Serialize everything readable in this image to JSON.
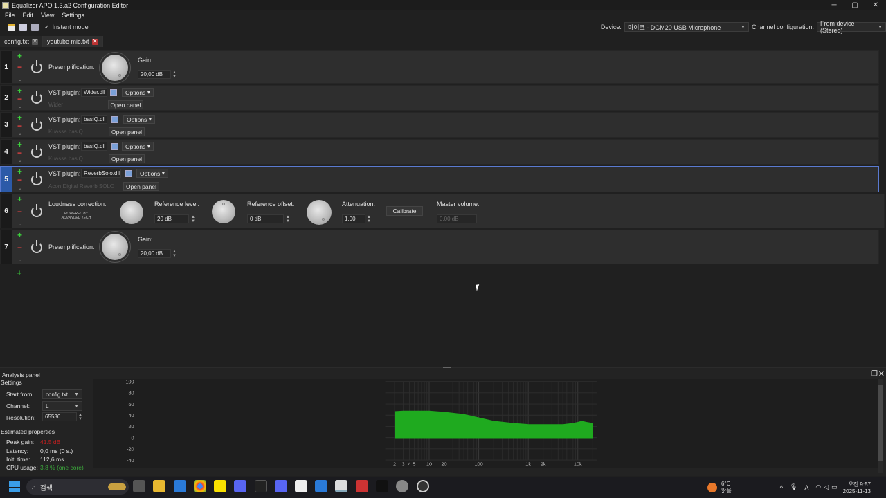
{
  "window": {
    "title": "Equalizer APO 1.3.a2 Configuration Editor",
    "min": "─",
    "max": "▢",
    "close": "✕"
  },
  "menu": [
    "File",
    "Edit",
    "View",
    "Settings"
  ],
  "toolbar": {
    "instant_mode": "Instant mode",
    "instant_checked": true
  },
  "device": {
    "label": "Device:",
    "value": "마이크 - DGM20 USB Microphone",
    "channel_label": "Channel configuration:",
    "channel_value": "From device (Stereo)"
  },
  "tabs": [
    {
      "label": "config.txt",
      "active": false
    },
    {
      "label": "youtube mic.txt",
      "active": true
    }
  ],
  "rows": [
    {
      "num": "1",
      "type": "preamp",
      "label": "Preamplification:",
      "gain_label": "Gain:",
      "gain_value": "20,00 dB"
    },
    {
      "num": "2",
      "type": "vst",
      "label": "VST plugin:",
      "file": "Wider.dll",
      "options": "Options",
      "open": "Open panel",
      "plugin_name": "Wider"
    },
    {
      "num": "3",
      "type": "vst",
      "label": "VST plugin:",
      "file": "basiQ.dll",
      "options": "Options",
      "open": "Open panel",
      "plugin_name": "Kuassa basiQ"
    },
    {
      "num": "4",
      "type": "vst",
      "label": "VST plugin:",
      "file": "basiQ.dll",
      "options": "Options",
      "open": "Open panel",
      "plugin_name": "Kuassa basiQ"
    },
    {
      "num": "5",
      "type": "vst",
      "label": "VST plugin:",
      "file": "ReverbSolo.dll",
      "options": "Options",
      "open": "Open panel",
      "plugin_name": "Acon Digital Reverb SOLO",
      "selected": true
    },
    {
      "num": "6",
      "type": "loudness",
      "label": "Loudness correction:",
      "powered_by": "POWERED BY ADVANCED TECH",
      "ref_level_label": "Reference level:",
      "ref_level": "20 dB",
      "ref_offset_label": "Reference offset:",
      "ref_offset": "0 dB",
      "atten_label": "Attenuation:",
      "atten": "1,00",
      "calibrate": "Calibrate",
      "master_label": "Master volume:",
      "master": "0,00 dB"
    },
    {
      "num": "7",
      "type": "preamp",
      "label": "Preamplification:",
      "gain_label": "Gain:",
      "gain_value": "20,00 dB"
    }
  ],
  "analysis": {
    "title": "Analysis panel",
    "settings": "Settings",
    "start_from_label": "Start from:",
    "start_from": "config.txt",
    "channel_label": "Channel:",
    "channel": "L",
    "resolution_label": "Resolution:",
    "resolution": "65536",
    "estimated": "Estimated properties",
    "peak_label": "Peak gain:",
    "peak": "41.5 dB",
    "peak_color": "#c02020",
    "latency_label": "Latency:",
    "latency": "0,0 ms (0 s.)",
    "init_label": "Init. time:",
    "init": "112,6 ms",
    "cpu_label": "CPU usage:",
    "cpu": "3,8 % (one core)",
    "cpu_color": "#3caa3c"
  },
  "chart_data": {
    "type": "area",
    "y_ticks": [
      "100",
      "80",
      "60",
      "40",
      "20",
      "0",
      "-20",
      "-40"
    ],
    "x_ticks": [
      "2",
      "3",
      "4",
      "5",
      "10",
      "20",
      "100",
      "1k",
      "2k",
      "10k"
    ],
    "ylim": [
      -40,
      100
    ],
    "x_scale": "log",
    "grid": true,
    "fill_color": "#1faa1f",
    "x": [
      2,
      3,
      5,
      10,
      20,
      50,
      100,
      200,
      500,
      1000,
      2000,
      5000,
      8000,
      10000,
      12000,
      15000,
      20000
    ],
    "values": [
      47,
      48,
      48,
      48,
      46,
      42,
      36,
      30,
      26,
      24,
      24,
      24,
      26,
      28,
      30,
      28,
      26
    ],
    "floor": -1
  },
  "taskbar": {
    "search": "검색",
    "weather_temp": "6°C",
    "weather_cond": "맑음",
    "time": "오전 9:57",
    "date": "2025-11-13",
    "ime": "A"
  }
}
